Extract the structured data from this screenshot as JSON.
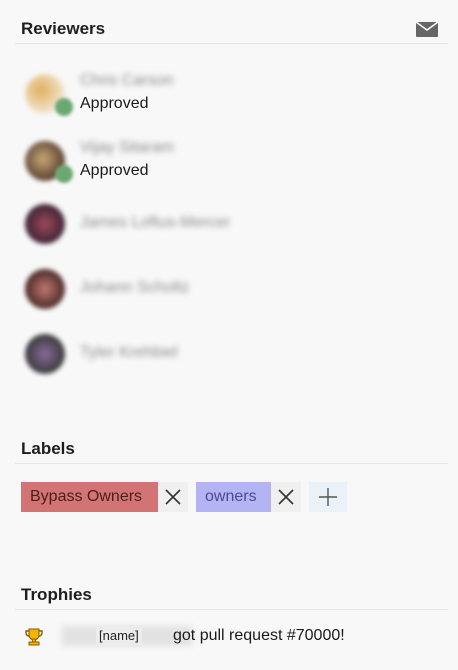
{
  "reviewers_section": {
    "title": "Reviewers",
    "action_icon": "mail-icon",
    "items": [
      {
        "name": "Chris Carson",
        "status": "Approved",
        "avatar_color": "#c89a52",
        "vote": "approved"
      },
      {
        "name": "Vijay Sitaram",
        "status": "Approved",
        "avatar_color": "#7a5a40",
        "vote": "approved"
      },
      {
        "name": "James Loftus-Mercer",
        "status": "",
        "avatar_color": "#6e2e36",
        "vote": ""
      },
      {
        "name": "Johann Scholtz",
        "status": "",
        "avatar_color": "#7a3a38",
        "vote": ""
      },
      {
        "name": "Tyler Krehbiel",
        "status": "",
        "avatar_color": "#4e3e5e",
        "vote": ""
      }
    ]
  },
  "labels_section": {
    "title": "Labels",
    "labels": [
      {
        "text": "Bypass Owners",
        "bg": "#d27474",
        "fg": "#4a1e1e"
      },
      {
        "text": "owners",
        "bg": "#b4b4f4",
        "fg": "#4a4a9a"
      }
    ],
    "add_icon": "plus-icon",
    "remove_icon": "close-icon"
  },
  "trophies_section": {
    "title": "Trophies",
    "trophy": {
      "icon": "trophy-icon",
      "user_tag": "[name]",
      "text": "got pull request #70000!"
    }
  }
}
